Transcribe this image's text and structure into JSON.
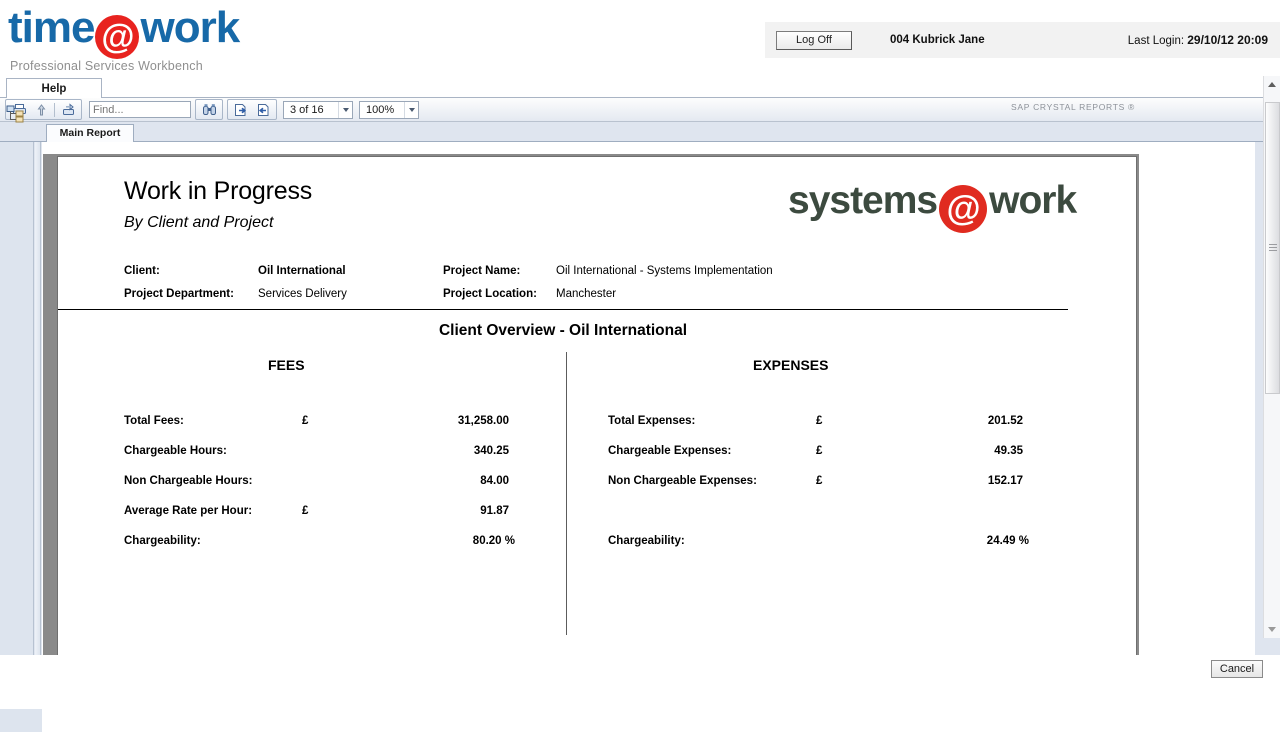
{
  "app": {
    "brand_left": "time",
    "brand_at": "@",
    "brand_right": "work",
    "tagline": "Professional Services Workbench",
    "logoff_label": "Log Off",
    "user": "004 Kubrick Jane",
    "last_login_label": "Last Login:",
    "last_login_value": "29/10/12 20:09",
    "accent_blue": "#1769a8",
    "accent_red": "#e8231f"
  },
  "viewer": {
    "help_tab": "Help",
    "find_placeholder": "Find...",
    "page_indicator": "3 of 16",
    "zoom_level": "100%",
    "crystal_brand": "SAP CRYSTAL REPORTS ®",
    "main_report_tab": "Main Report",
    "toolbar_icons": [
      "print-icon",
      "export-up-icon",
      "export-icon",
      "find-binoculars-icon",
      "next-page-icon",
      "previous-page-icon"
    ],
    "group_tree_icon": "group-tree-icon"
  },
  "report": {
    "title": "Work in Progress",
    "subtitle": "By Client and Project",
    "logo": {
      "left": "systems",
      "at": "@",
      "right": "work",
      "text_color": "#3c4a3f",
      "at_color": "#e02b20"
    },
    "meta": [
      {
        "label": "Client:",
        "value": "Oil International",
        "bold": true
      },
      {
        "label": "Project Name:",
        "value": "Oil International - Systems Implementation",
        "bold": false
      },
      {
        "label": "Project Department:",
        "value": "Services Delivery",
        "bold": false
      },
      {
        "label": "Project Location:",
        "value": "Manchester",
        "bold": false
      }
    ],
    "overview_title": "Client Overview - Oil International",
    "fees": {
      "heading": "FEES",
      "rows": [
        {
          "label": "Total Fees:",
          "currency": "£",
          "value": "31,258.00"
        },
        {
          "label": "Chargeable Hours:",
          "currency": "",
          "value": "340.25"
        },
        {
          "label": "Non Chargeable Hours:",
          "currency": "",
          "value": "84.00"
        },
        {
          "label": "Average Rate per Hour:",
          "currency": "£",
          "value": "91.87"
        },
        {
          "label": "Chargeability:",
          "currency": "",
          "value": "80.20 %"
        }
      ]
    },
    "expenses": {
      "heading": "EXPENSES",
      "rows": [
        {
          "label": "Total Expenses:",
          "currency": "£",
          "value": "201.52"
        },
        {
          "label": "Chargeable Expenses:",
          "currency": "£",
          "value": "49.35"
        },
        {
          "label": "Non Chargeable Expenses:",
          "currency": "£",
          "value": "152.17"
        },
        {
          "label": "",
          "currency": "",
          "value": ""
        },
        {
          "label": "Chargeability:",
          "currency": "",
          "value": "24.49 %"
        }
      ]
    }
  },
  "footer": {
    "cancel_label": "Cancel"
  }
}
